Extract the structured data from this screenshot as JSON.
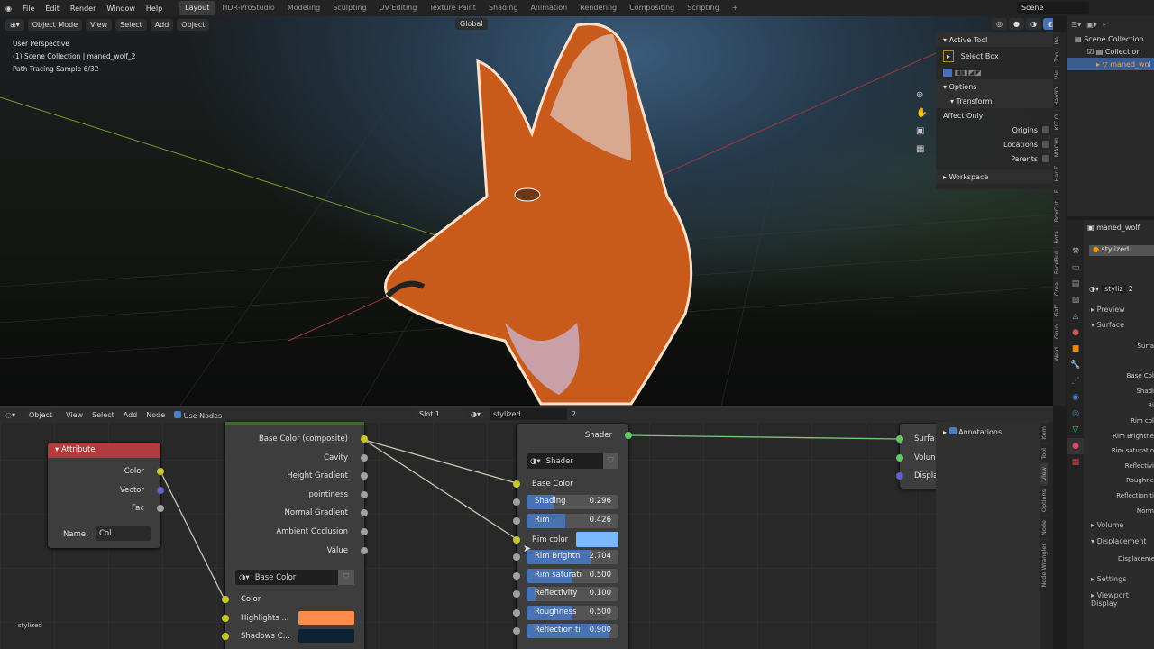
{
  "menu": [
    "File",
    "Edit",
    "Render",
    "Window",
    "Help"
  ],
  "workspaces": [
    "Layout",
    "HDR-ProStudio",
    "Modeling",
    "Sculpting",
    "UV Editing",
    "Texture Paint",
    "Shading",
    "Animation",
    "Rendering",
    "Compositing",
    "Scripting",
    "+"
  ],
  "scene": "Scene",
  "viewport": {
    "mode": "Object Mode",
    "menus": [
      "View",
      "Select",
      "Add",
      "Object"
    ],
    "orientation": "Global",
    "info": [
      "User Perspective",
      "(1) Scene Collection | maned_wolf_2",
      "Path Tracing Sample 6/32"
    ]
  },
  "npanel": {
    "active_tool": "Active Tool",
    "select_box": "Select Box",
    "options": "Options",
    "transform": "Transform",
    "affect_only": "Affect Only",
    "origins": "Origins",
    "locations": "Locations",
    "parents": "Parents",
    "workspace": "Workspace",
    "tabs": [
      "Ite",
      "Too",
      "Vie",
      "HardO",
      "KIT O",
      "MACHI",
      "Har T",
      "E",
      "BoxCut",
      "bota",
      "FaceBul",
      "Crea",
      "Gaff",
      "Grun",
      "Weld"
    ]
  },
  "outliner": {
    "scene_collection": "Scene Collection",
    "collection": "Collection",
    "object": "maned_wol"
  },
  "props": {
    "object": "maned_wolf",
    "material": "stylized",
    "slot_name": "styliz",
    "users": "2",
    "preview": "Preview",
    "surface": "Surface",
    "rows": [
      "Surfa",
      "Base Col",
      "Shadi",
      "Ri",
      "Rim col",
      "Rim Brightne",
      "Rim saturatio",
      "Reflectivi",
      "Roughne",
      "Reflection ti",
      "Norm"
    ],
    "volume": "Volume",
    "displacement": "Displacement",
    "displacement_row": "Displaceme",
    "settings": "Settings",
    "viewport_display": "Viewport Display"
  },
  "node_editor": {
    "mode": "Object",
    "menus": [
      "View",
      "Select",
      "Add",
      "Node"
    ],
    "use_nodes": "Use Nodes",
    "slot": "Slot 1",
    "material": "stylized",
    "users": "2",
    "footer": "stylized",
    "tabs": [
      "Item",
      "Tool",
      "View",
      "Options",
      "Node",
      "Node Wrangler"
    ],
    "annotations": "Annotations"
  },
  "attribute_node": {
    "title": "Attribute",
    "outputs": [
      "Color",
      "Vector",
      "Fac"
    ],
    "name_label": "Name:",
    "name_value": "Col"
  },
  "group_node": {
    "outputs": [
      "Base Color (composite)",
      "Cavity",
      "Height Gradient",
      "pointiness",
      "Normal Gradient",
      "Ambient Occlusion",
      "Value"
    ],
    "group": "Base Color",
    "inputs": [
      "Color",
      "Highlights ...",
      "Shadows C..."
    ],
    "highlight_color": "#ff8c4f",
    "shadow_color": "#0d2333"
  },
  "shader_node": {
    "output": "Shader",
    "group": "Shader",
    "base_color": "Base Color",
    "fields": [
      {
        "label": "Shading",
        "value": "0.296",
        "frac": 0.296
      },
      {
        "label": "Rim",
        "value": "0.426",
        "frac": 0.426
      }
    ],
    "rim_color_label": "Rim color",
    "rim_color": "#79b8ff",
    "fields2": [
      {
        "label": "Rim Brightn",
        "value": "2.704",
        "frac": 0.7
      },
      {
        "label": "Rim saturati",
        "value": "0.500",
        "frac": 0.5
      },
      {
        "label": "Reflectivity",
        "value": "0.100",
        "frac": 0.1
      },
      {
        "label": "Roughness",
        "value": "0.500",
        "frac": 0.5
      },
      {
        "label": "Reflection ti",
        "value": "0.900",
        "frac": 0.9
      }
    ]
  },
  "output_node": {
    "inputs": [
      "Surfa",
      "Volun",
      "Displa"
    ]
  }
}
